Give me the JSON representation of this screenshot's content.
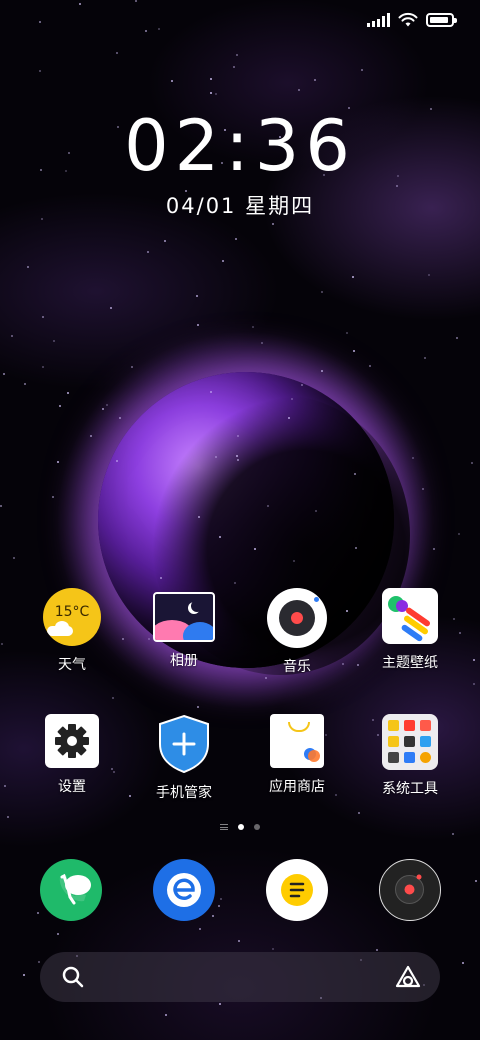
{
  "status_bar": {
    "signal": "signal-icon",
    "wifi": "wifi-icon",
    "battery_level": 0.9
  },
  "lock_clock": {
    "time": "02:36",
    "date": "04/01 星期四"
  },
  "home_apps": {
    "row1": [
      {
        "label": "天气",
        "icon": "weather-icon",
        "badge_text": "15°C"
      },
      {
        "label": "相册",
        "icon": "gallery-icon"
      },
      {
        "label": "音乐",
        "icon": "music-icon"
      },
      {
        "label": "主题壁纸",
        "icon": "themes-icon"
      }
    ],
    "row2": [
      {
        "label": "设置",
        "icon": "settings-icon"
      },
      {
        "label": "手机管家",
        "icon": "security-icon"
      },
      {
        "label": "应用商店",
        "icon": "app-store-icon"
      },
      {
        "label": "系统工具",
        "icon": "system-tools-folder-icon"
      }
    ]
  },
  "pages": {
    "count": 2,
    "active_index": 0
  },
  "dock": [
    {
      "icon": "phone-icon"
    },
    {
      "icon": "browser-icon"
    },
    {
      "icon": "notes-icon"
    },
    {
      "icon": "recorder-icon"
    }
  ],
  "search": {
    "search_icon": "search-icon",
    "assistant_icon": "assistant-icon"
  },
  "colors": {
    "weather": "#f5c518",
    "security_blue": "#2e8de6",
    "phone_green": "#1fba6a",
    "browser_blue": "#1e6fe6",
    "notes_yellow": "#ffcc00"
  }
}
